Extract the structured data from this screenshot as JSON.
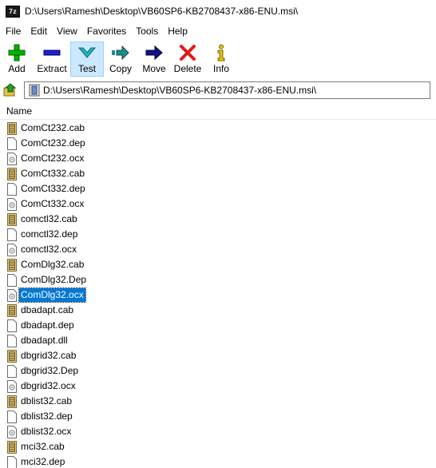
{
  "window": {
    "title": "D:\\Users\\Ramesh\\Desktop\\VB60SP6-KB2708437-x86-ENU.msi\\",
    "app_icon_text": "7z"
  },
  "menu": [
    "File",
    "Edit",
    "View",
    "Favorites",
    "Tools",
    "Help"
  ],
  "toolbar": [
    {
      "label": "Add",
      "icon": "add-icon",
      "color": "#00b400"
    },
    {
      "label": "Extract",
      "icon": "extract-icon",
      "color": "#1e1ed2"
    },
    {
      "label": "Test",
      "icon": "test-icon",
      "color": "#1fb5c6",
      "selected": true
    },
    {
      "label": "Copy",
      "icon": "copy-icon",
      "color": "#1e8c8c"
    },
    {
      "label": "Move",
      "icon": "move-icon",
      "color": "#101080"
    },
    {
      "label": "Delete",
      "icon": "delete-icon",
      "color": "#e01a1a"
    },
    {
      "label": "Info",
      "icon": "info-icon",
      "color": "#e8c000"
    }
  ],
  "address": {
    "value": "D:\\Users\\Ramesh\\Desktop\\VB60SP6-KB2708437-x86-ENU.msi\\"
  },
  "columns": {
    "name": "Name"
  },
  "files": [
    {
      "name": "ComCt232.cab",
      "type": "cab"
    },
    {
      "name": "ComCt232.dep",
      "type": "doc"
    },
    {
      "name": "ComCt232.ocx",
      "type": "ocx"
    },
    {
      "name": "ComCt332.cab",
      "type": "cab"
    },
    {
      "name": "ComCt332.dep",
      "type": "doc"
    },
    {
      "name": "ComCt332.ocx",
      "type": "ocx"
    },
    {
      "name": "comctl32.cab",
      "type": "cab"
    },
    {
      "name": "comctl32.dep",
      "type": "doc"
    },
    {
      "name": "comctl32.ocx",
      "type": "ocx"
    },
    {
      "name": "ComDlg32.cab",
      "type": "cab"
    },
    {
      "name": "ComDlg32.Dep",
      "type": "doc"
    },
    {
      "name": "ComDlg32.ocx",
      "type": "ocx",
      "selected": true
    },
    {
      "name": "dbadapt.cab",
      "type": "cab"
    },
    {
      "name": "dbadapt.dep",
      "type": "doc"
    },
    {
      "name": "dbadapt.dll",
      "type": "doc"
    },
    {
      "name": "dbgrid32.cab",
      "type": "cab"
    },
    {
      "name": "dbgrid32.Dep",
      "type": "doc"
    },
    {
      "name": "dbgrid32.ocx",
      "type": "ocx"
    },
    {
      "name": "dblist32.cab",
      "type": "cab"
    },
    {
      "name": "dblist32.dep",
      "type": "doc"
    },
    {
      "name": "dblist32.ocx",
      "type": "ocx"
    },
    {
      "name": "mci32.cab",
      "type": "cab"
    },
    {
      "name": "mci32.dep",
      "type": "doc"
    }
  ]
}
